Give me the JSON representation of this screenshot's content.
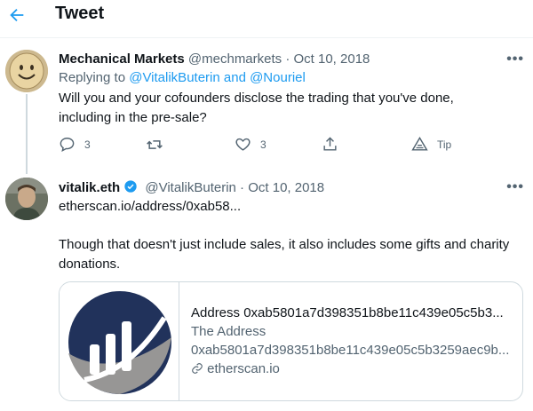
{
  "header": {
    "title": "Tweet",
    "back_icon": "arrow-left-icon"
  },
  "colors": {
    "accent": "#1d9bf0",
    "text": "#0f1419",
    "muted": "#536471",
    "border": "#cfd9de"
  },
  "tweet1": {
    "name": "Mechanical Markets",
    "handle": "@mechmarkets",
    "sep": "·",
    "date": "Oct 10, 2018",
    "more": "•••",
    "reply_prefix": "Replying to",
    "reply_users": "@VitalikButerin and @Nouriel",
    "text_line1": "Will you and your cofounders disclose the trading that you've done,",
    "text_line2": "including in the pre-sale?",
    "actions": {
      "reply_count": "3",
      "like_count": "3",
      "tip_label": "Tip"
    }
  },
  "tweet2": {
    "name": "vitalik.eth",
    "handle": "@VitalikButerin",
    "sep": "·",
    "date": "Oct 10, 2018",
    "more": "•••",
    "link": "etherscan.io/address/0xab58...",
    "text_line1": "Though that doesn't just include sales, it also includes some gifts and charity",
    "text_line2": "donations.",
    "card": {
      "title": "Address 0xab5801a7d398351b8be11c439e05c5b3...",
      "desc_line1": "The Address",
      "desc_line2": "0xab5801a7d398351b8be11c439e05c5b3259aec9b...",
      "domain": "etherscan.io"
    }
  }
}
